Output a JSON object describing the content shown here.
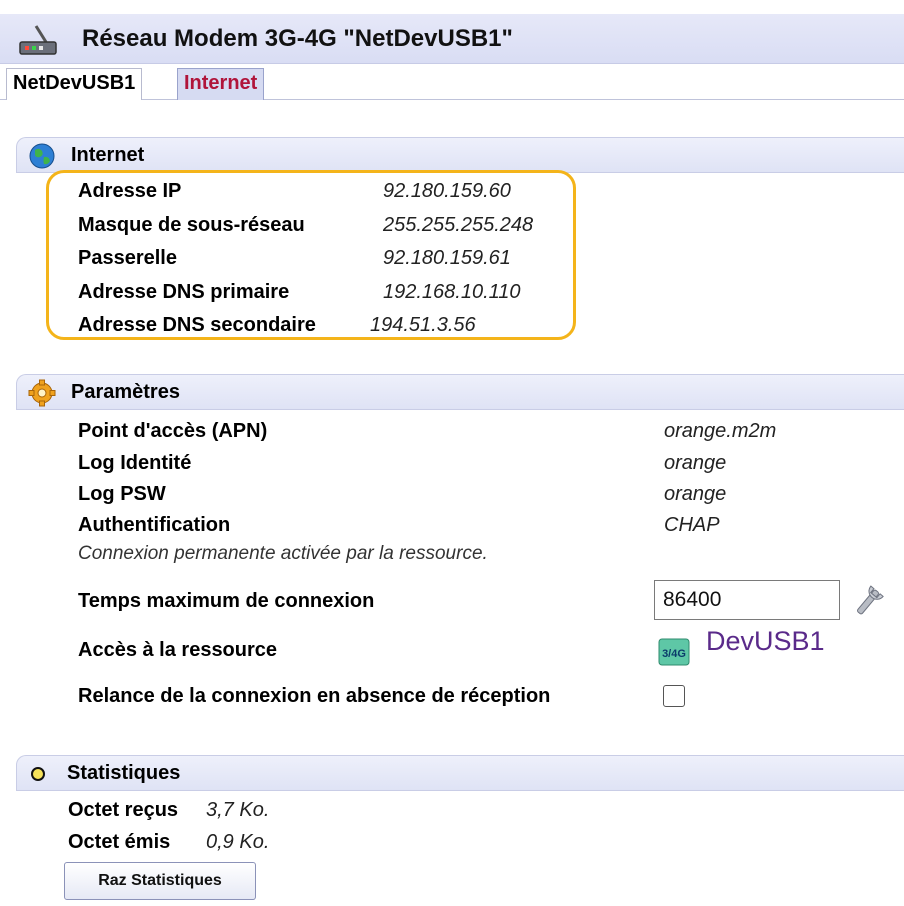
{
  "window": {
    "title": "Réseau Modem 3G-4G \"NetDevUSB1\""
  },
  "tabs": [
    {
      "label": "NetDevUSB1",
      "active": false
    },
    {
      "label": "Internet",
      "active": true
    }
  ],
  "internet": {
    "header": "Internet",
    "rows": [
      {
        "label": "Adresse IP",
        "value": "92.180.159.60"
      },
      {
        "label": "Masque de sous-réseau",
        "value": "255.255.255.248"
      },
      {
        "label": "Passerelle",
        "value": "92.180.159.61"
      },
      {
        "label": "Adresse DNS primaire",
        "value": "192.168.10.110"
      },
      {
        "label": "Adresse DNS secondaire",
        "value": "194.51.3.56"
      }
    ]
  },
  "parametres": {
    "header": "Paramètres",
    "rows": [
      {
        "label": "Point d'accès (APN)",
        "value": "orange.m2m"
      },
      {
        "label": "Log Identité",
        "value": "orange"
      },
      {
        "label": "Log PSW",
        "value": "orange"
      },
      {
        "label": "Authentification",
        "value": "CHAP"
      }
    ],
    "info": "Connexion permanente activée par la ressource.",
    "max_time": {
      "label": "Temps maximum de connexion",
      "value": "86400"
    },
    "resource": {
      "label": "Accès à la ressource",
      "icon_text": "3/4G",
      "link": "DevUSB1"
    },
    "relance": {
      "label": "Relance de la connexion en absence de réception",
      "checked": false
    }
  },
  "statistiques": {
    "header": "Statistiques",
    "rows": [
      {
        "label": "Octet reçus",
        "value": "3,7 Ko."
      },
      {
        "label": "Octet émis",
        "value": "0,9 Ko."
      }
    ],
    "button": "Raz Statistiques"
  },
  "colors": {
    "highlight": "#f4b41a",
    "active_tab": "#b0143a",
    "link": "#5a2a8a"
  },
  "icons": [
    "modem-icon",
    "globe-icon",
    "gear-icon",
    "wrench-icon",
    "3g4g-icon",
    "circle-icon"
  ]
}
